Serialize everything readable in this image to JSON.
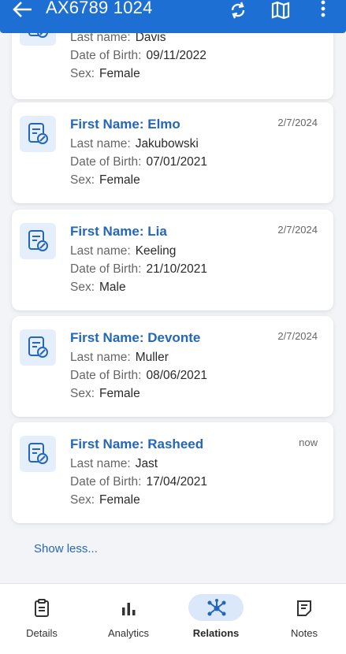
{
  "appbar": {
    "title": "AX6789 1024"
  },
  "cards": [
    {
      "name": "",
      "time": "",
      "last_name_label": "Last name:",
      "last_name": "Davis",
      "dob_label": "Date of Birth:",
      "dob": "09/11/2022",
      "sex_label": "Sex:",
      "sex": "Female"
    },
    {
      "name": "First Name: Elmo",
      "time": "2/7/2024",
      "last_name_label": "Last name:",
      "last_name": "Jakubowski",
      "dob_label": "Date of Birth:",
      "dob": "07/01/2021",
      "sex_label": "Sex:",
      "sex": "Female"
    },
    {
      "name": "First Name: Lia",
      "time": "2/7/2024",
      "last_name_label": "Last name:",
      "last_name": "Keeling",
      "dob_label": "Date of Birth:",
      "dob": "21/10/2021",
      "sex_label": "Sex:",
      "sex": "Male"
    },
    {
      "name": "First Name: Devonte",
      "time": "2/7/2024",
      "last_name_label": "Last name:",
      "last_name": "Muller",
      "dob_label": "Date of Birth:",
      "dob": "08/06/2021",
      "sex_label": "Sex:",
      "sex": "Female"
    },
    {
      "name": "First Name: Rasheed",
      "time": "now",
      "last_name_label": "Last name:",
      "last_name": "Jast",
      "dob_label": "Date of Birth:",
      "dob": "17/04/2021",
      "sex_label": "Sex:",
      "sex": "Female"
    }
  ],
  "show_less": "Show less...",
  "nav": [
    {
      "label": "Details",
      "icon": "clipboard-icon"
    },
    {
      "label": "Analytics",
      "icon": "bar-chart-icon"
    },
    {
      "label": "Relations",
      "icon": "network-icon",
      "active": true
    },
    {
      "label": "Notes",
      "icon": "notes-icon"
    }
  ],
  "colors": {
    "primary": "#1d6fd4",
    "name_text": "#2467b8",
    "active_pill": "#dbe8f9"
  }
}
